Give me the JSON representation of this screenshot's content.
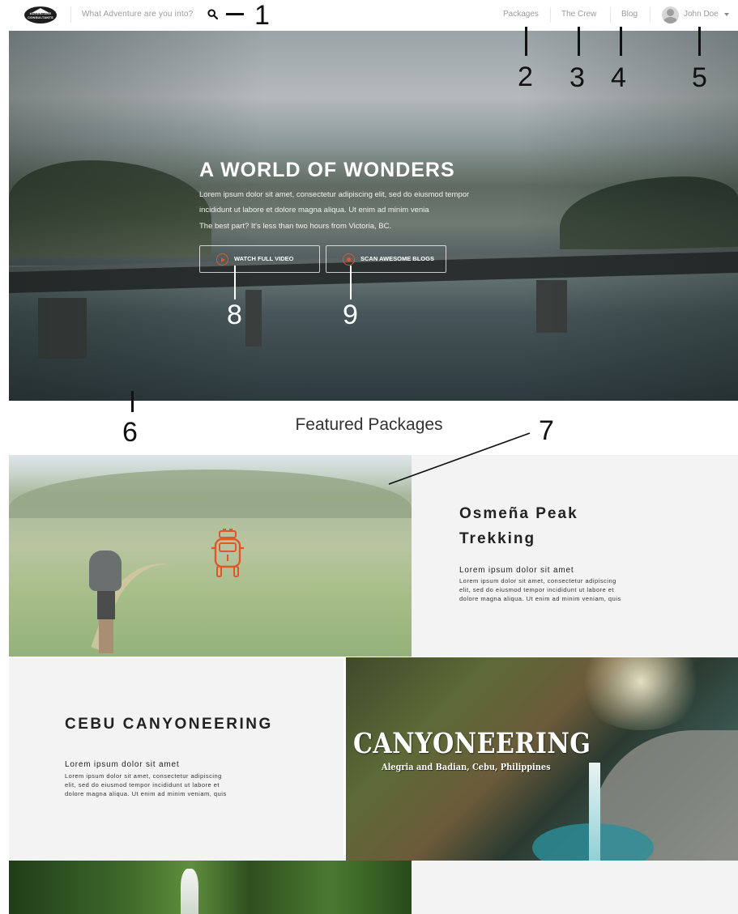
{
  "header": {
    "logo_text": "ADVENTURE CONSULTANTS",
    "search_placeholder": "What Adventure are you into?",
    "nav": [
      "Packages",
      "The Crew",
      "Blog"
    ],
    "user_name": "John Doe"
  },
  "hero": {
    "title": "A WORLD OF WONDERS",
    "lines": [
      "Lorem ipsum dolor sit amet, consectetur adipiscing elit, sed do eiusmod tempor",
      "incididunt ut labore et dolore magna aliqua. Ut enim ad minim venia",
      "The best part? It's less than two hours from Victoria, BC."
    ],
    "buttons": [
      "WATCH FULL VIDEO",
      "SCAN AWESOME BLOGS"
    ]
  },
  "annotations": [
    "1",
    "2",
    "3",
    "4",
    "5",
    "6",
    "7",
    "8",
    "9"
  ],
  "featured": {
    "heading": "Featured Packages",
    "packages": [
      {
        "title_line1": "Osmeña Peak",
        "title_line2": "Trekking",
        "subtitle": "Lorem ipsum dolor sit amet",
        "body": [
          "Lorem ipsum dolor sit amet, consectetur adipiscing",
          "elit, sed do eiusmod tempor incididunt ut labore et",
          "dolore magna aliqua. Ut enim ad minim veniam, quis"
        ]
      },
      {
        "title": "CEBU CANYONEERING",
        "subtitle": "Lorem ipsum dolor sit amet",
        "body": [
          "Lorem ipsum dolor sit amet, consectetur adipiscing",
          "elit, sed do eiusmod tempor incididunt ut labore et",
          "dolore magna aliqua. Ut enim ad minim veniam, quis"
        ],
        "image_title": "CANYONEERING",
        "image_caption": "Alegria and Badian, Cebu, Philippines"
      }
    ]
  },
  "colors": {
    "accent": "#e0582a",
    "card_bg": "#f3f3f3",
    "annotation": "#111111"
  }
}
